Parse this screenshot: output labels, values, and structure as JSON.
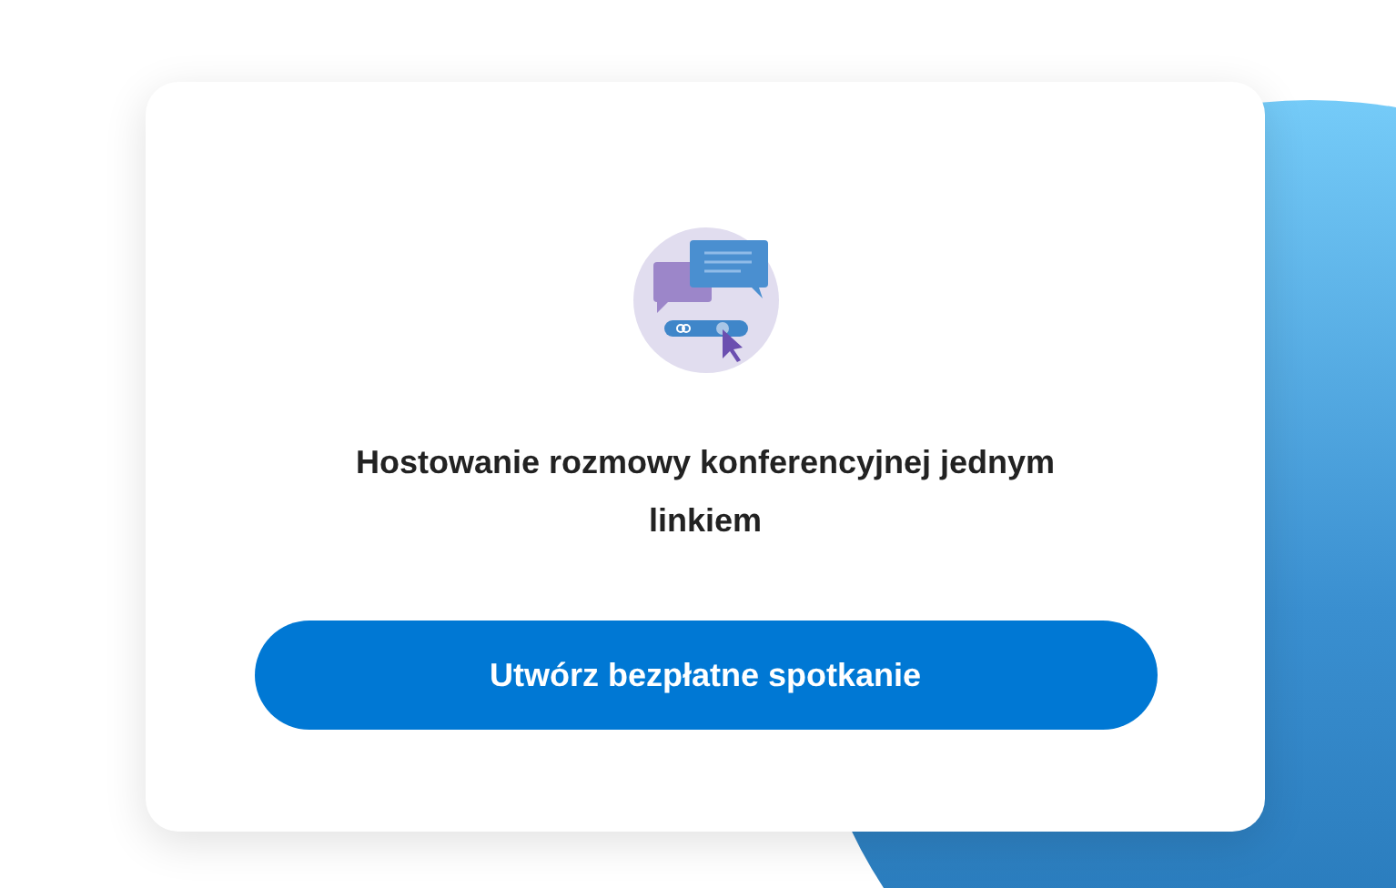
{
  "card": {
    "title": "Hostowanie rozmowy konferencyjnej jednym linkiem",
    "button": "Utwórz bezpłatne spotkanie"
  }
}
